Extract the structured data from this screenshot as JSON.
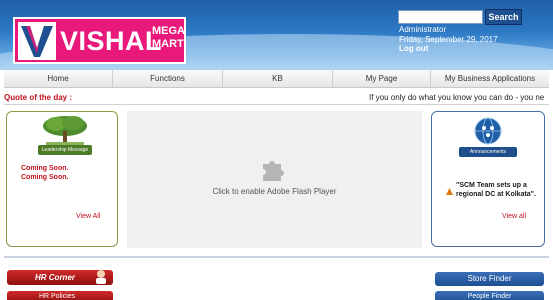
{
  "brand": {
    "name": "VISHAL",
    "mega": "MEGA",
    "mart": "MART",
    "logo_color": "#e8197a"
  },
  "search": {
    "placeholder": "",
    "button_label": "Search"
  },
  "user": {
    "name": "Administrator",
    "date": "Friday, September 29, 2017",
    "logout_label": "Log out"
  },
  "nav": {
    "items": [
      "Home",
      "Functions",
      "KB",
      "My Page",
      "My Business Applications"
    ]
  },
  "quote": {
    "label": "Quote of the day :",
    "text": "If you only do what you know you can do - you ne"
  },
  "leadership": {
    "badge": "Leadership Message",
    "lines": [
      "Coming Soon.",
      "Coming Soon."
    ],
    "view_all": "View All"
  },
  "flash": {
    "text": "Click to enable Adobe Flash Player"
  },
  "announcements": {
    "badge": "Announcements",
    "item": "\"SCM Team sets up a regional DC at Kolkata\".",
    "view_all": "View all"
  },
  "widgets": {
    "hr_corner": "HR Corner",
    "hr_policies": "HR Policies",
    "store_finder": "Store Finder",
    "people_finder": "People Finder"
  },
  "colors": {
    "header_blue": "#2d78c4",
    "accent_red": "#c1121f",
    "button_blue": "#1d4f91"
  }
}
